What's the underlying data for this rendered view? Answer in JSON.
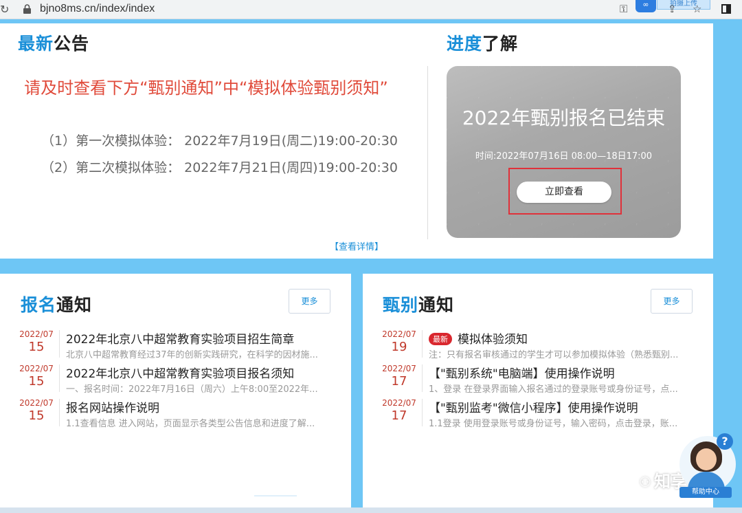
{
  "browser": {
    "url": "bjno8ms.cn/index/index",
    "extension_tag": "拍摄上传"
  },
  "announcement": {
    "title_highlight": "最新",
    "title_rest": "公告",
    "headline": "请及时查看下方“甄别通知”中“模拟体验甄别须知”",
    "lines": [
      "（1）第一次模拟体验：  2022年7月19日(周二)19:00-20:30",
      "（2）第二次模拟体验：  2022年7月21日(周四)19:00-20:30"
    ],
    "detail_link": "【查看详情】"
  },
  "progress": {
    "title_highlight": "进度",
    "title_rest": "了解",
    "card_title": "2022年甄别报名已结束",
    "card_time": "时间:2022年07月16日 08:00—18日17:00",
    "view_button": "立即查看"
  },
  "registration": {
    "title_highlight": "报名",
    "title_rest": "通知",
    "more": "更多",
    "items": [
      {
        "ym": "2022/07",
        "day": "15",
        "title": "2022年北京八中超常教育实验项目招生简章",
        "desc": "北京八中超常教育经过37年的创新实践研究，在科学的因材施..."
      },
      {
        "ym": "2022/07",
        "day": "15",
        "title": "2022年北京八中超常教育实验项目报名须知",
        "desc": "一、报名时间：2022年7月16日（周六）上午8:00至2022年..."
      },
      {
        "ym": "2022/07",
        "day": "15",
        "title": "报名网站操作说明",
        "desc": "1.1查看信息 进入网站，页面显示各类型公告信息和进度了解..."
      }
    ]
  },
  "screening": {
    "title_highlight": "甄别",
    "title_rest": "通知",
    "more": "更多",
    "badge": "最新",
    "items": [
      {
        "ym": "2022/07",
        "day": "19",
        "title": "模拟体验须知",
        "desc": "注：只有报名审核通过的学生才可以参加模拟体验（熟悉甄别..."
      },
      {
        "ym": "2022/07",
        "day": "17",
        "title": "【\"甄别系统\"电脑端】使用操作说明",
        "desc": "1、登录 在登录界面输入报名通过的登录账号或身份证号，点..."
      },
      {
        "ym": "2022/07",
        "day": "17",
        "title": "【\"甄别监考\"微信小程序】使用操作说明",
        "desc": "1.1登录 使用登录账号或身份证号，输入密码，点击登录，账..."
      }
    ]
  },
  "help": {
    "q": "?",
    "label": "帮助中心"
  },
  "watermark": {
    "text": "知享堂"
  },
  "colors": {
    "accent": "#1a8fd8",
    "alert": "#e04a3a",
    "date": "#c0392b",
    "frame": "#6ec6f5"
  }
}
